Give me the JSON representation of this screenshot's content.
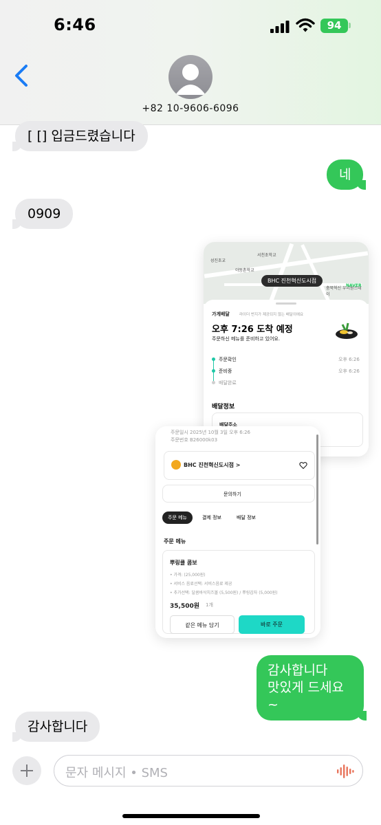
{
  "status_bar": {
    "time": "6:46",
    "battery": "94"
  },
  "header": {
    "contact": "+82 10-9606-6096"
  },
  "messages": [
    {
      "dir": "in",
      "text": "[ [] 입금드렸습니다"
    },
    {
      "dir": "out",
      "text": "네"
    },
    {
      "dir": "in",
      "text": "0909"
    },
    {
      "dir": "out",
      "lines": [
        "감사합니다",
        "맛있게 드세요~"
      ]
    },
    {
      "dir": "in",
      "text": "감사합니다"
    }
  ],
  "card1": {
    "map_labels": [
      "서천초학교",
      "야동촌학교",
      "성진초교",
      "충북혁신 우리원스테이",
      "NAVER"
    ],
    "store_pill": "BHC 진천혁신도시점",
    "delivery_type": "가게배달",
    "notice": "라이더 번지가 제공되지 않는 배달이에요",
    "eta": "오후 7:26 도착 예정",
    "status_text": "주문하신 메뉴를 준비하고 있어요.",
    "steps": [
      {
        "label": "주문확인",
        "time": "오후 6:26"
      },
      {
        "label": "준비중",
        "time": "오후 6:26"
      },
      {
        "label": "배달완료",
        "time": ""
      }
    ],
    "section_title": "배달정보",
    "address_label": "배달주소"
  },
  "card2": {
    "order_date": "주문일시 2025년 10월 3일 오후 6:26",
    "order_no": "주문번호 B26000k03",
    "store": "BHC 진천혁신도시점 >",
    "inquiry_button": "문의하기",
    "tabs": [
      "주문 메뉴",
      "결제 정보",
      "배달 정보"
    ],
    "menu_heading": "주문 메뉴",
    "menu_name": "뿌링클 콤보",
    "menu_details": [
      "• 가격: (25,000원)",
      "• 서비스 음료선택: 서비스음료 제공",
      "• 추가선택: 달콤바삭치즈볼 (5,500원) / 뿌링감자 (5,000원)"
    ],
    "price": "35,500원",
    "qty": "1개",
    "btn_same": "같은 메뉴 담기",
    "btn_order": "바로 주문"
  },
  "input": {
    "placeholder": "문자 메시지 • SMS"
  },
  "colors": {
    "outgoing": "#34c759",
    "incoming": "#e9e9eb",
    "accent": "#1ec7a6"
  }
}
